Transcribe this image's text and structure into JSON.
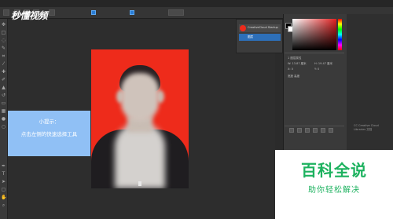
{
  "app": {
    "menu_items": [
      "",
      "",
      "",
      "",
      "",
      "",
      "",
      "",
      ""
    ],
    "watermark_top": "秒懂视频"
  },
  "hint": {
    "title": "小提示：",
    "body": "点击左侧的快速选择工具"
  },
  "layers": {
    "layer1": "CreativeCloud Startup",
    "layer2": "图层"
  },
  "properties": {
    "rows": [
      "1 图层属性",
      "W: 13.87 厘米",
      "H: 19.47 厘米",
      "X: 0",
      "Y: 0",
      "宽度  高度"
    ]
  },
  "right_panel_caption": "CC Creative Cloud Libraries 文档",
  "watermark": {
    "main": "百科全说",
    "sub": "助你轻松解决"
  },
  "colors": {
    "photo_background": "#ee2b1b",
    "hint_box": "#90c0f5",
    "watermark_green": "#1db25f"
  }
}
